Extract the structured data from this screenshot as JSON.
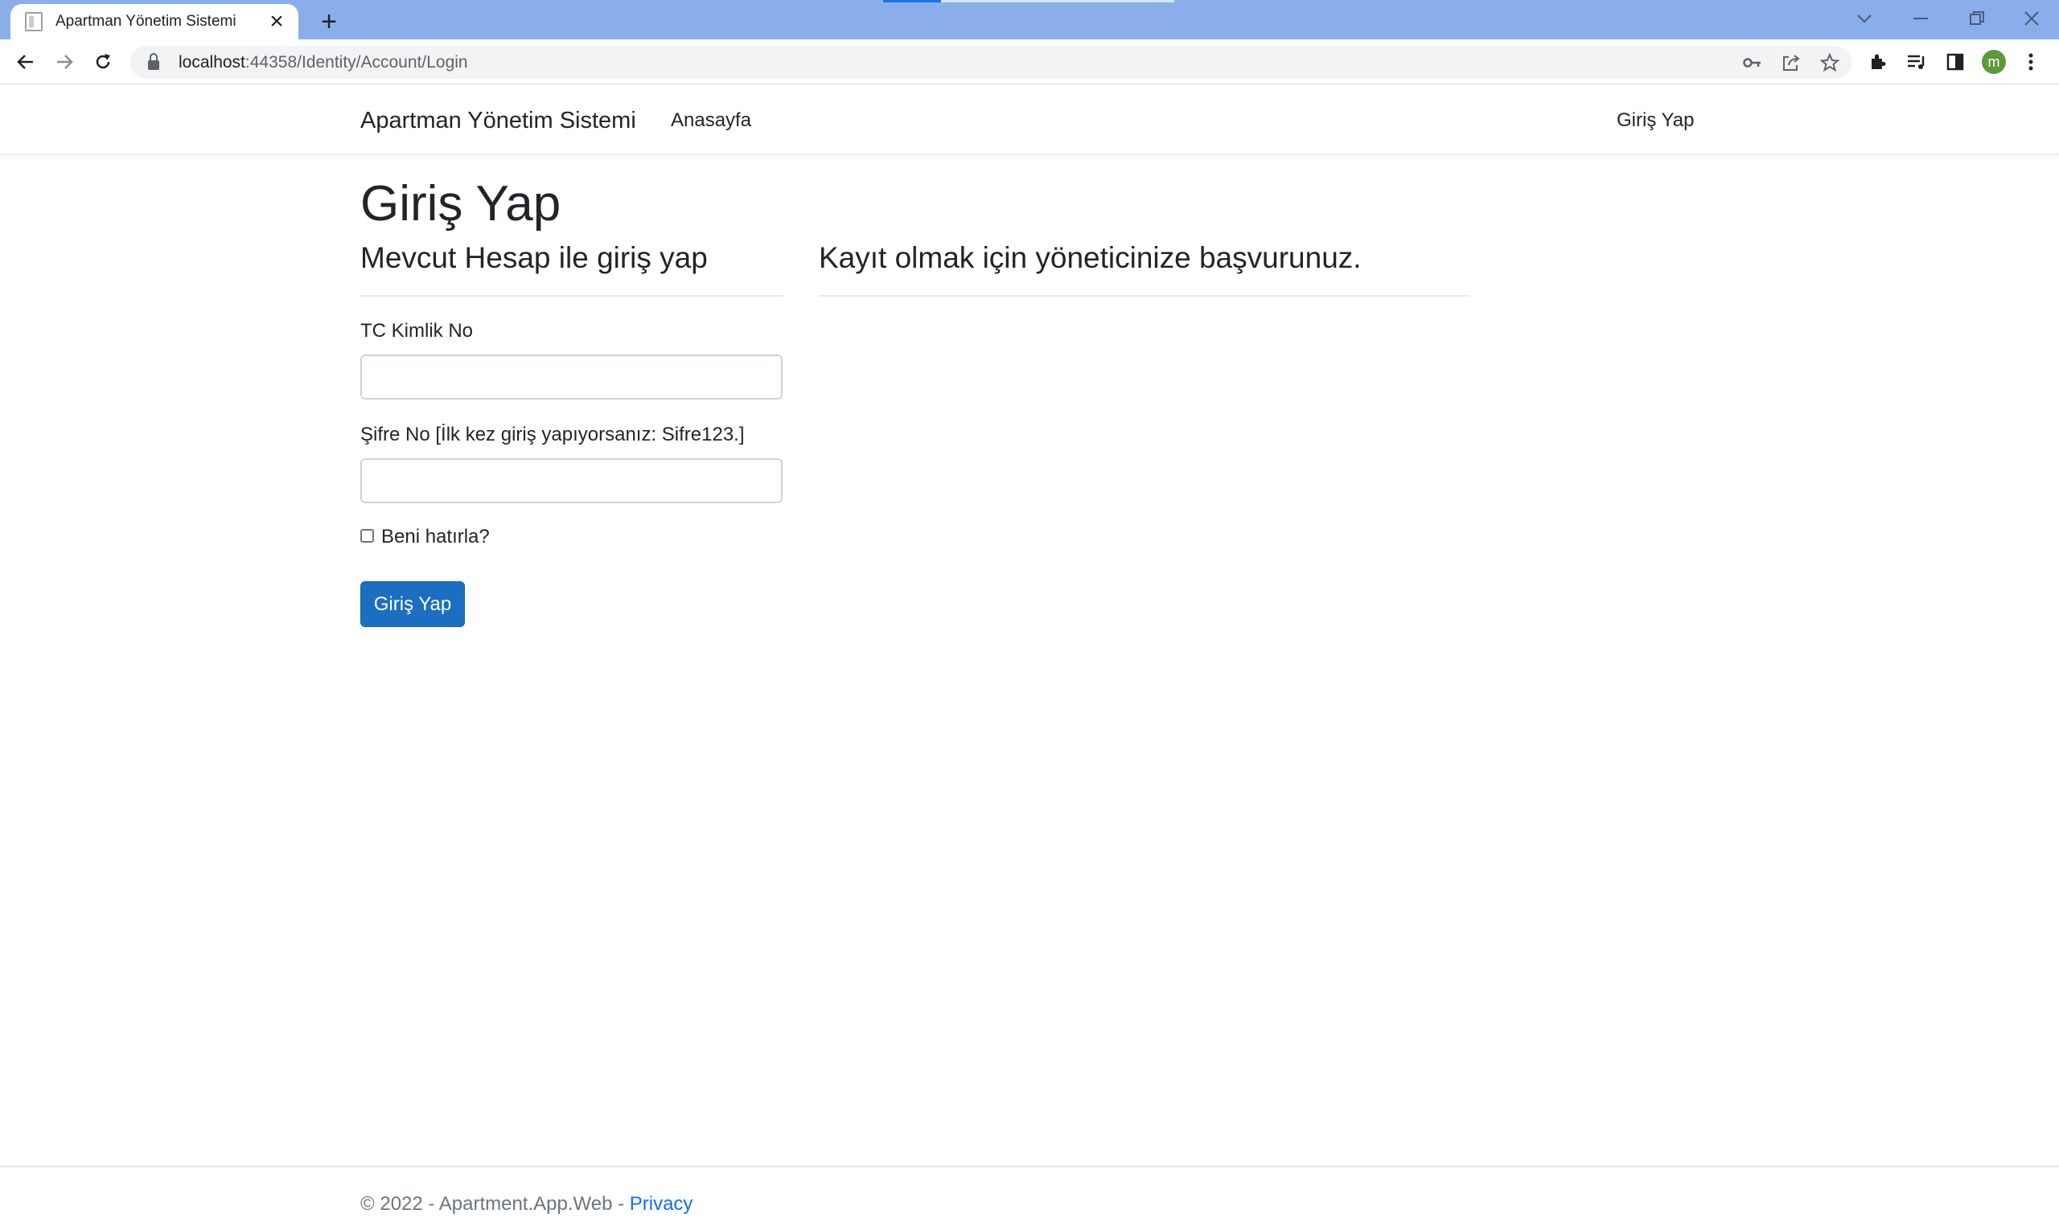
{
  "browser": {
    "tab_title": "Apartman Yönetim Sistemi",
    "url_host": "localhost",
    "url_rest": ":44358/Identity/Account/Login",
    "profile_initial": "m"
  },
  "navbar": {
    "brand": "Apartman Yönetim Sistemi",
    "home_link": "Anasayfa",
    "login_link": "Giriş Yap"
  },
  "main": {
    "title": "Giriş Yap",
    "left_heading": "Mevcut Hesap ile giriş yap",
    "right_heading": "Kayıt olmak için yöneticinize başvurunuz.",
    "tc_label": "TC Kimlik No",
    "tc_value": "",
    "password_label": "Şifre No [İlk kez giriş yapıyorsanız: Sifre123.]",
    "password_value": "",
    "remember_label": "Beni hatırla?",
    "submit_label": "Giriş Yap"
  },
  "footer": {
    "copyright": "© 2022 - Apartment.App.Web - ",
    "privacy_link": "Privacy"
  },
  "colors": {
    "titlebar": "#8aaeea",
    "primary_button": "#1b6ec2",
    "link": "#0d6efd"
  }
}
